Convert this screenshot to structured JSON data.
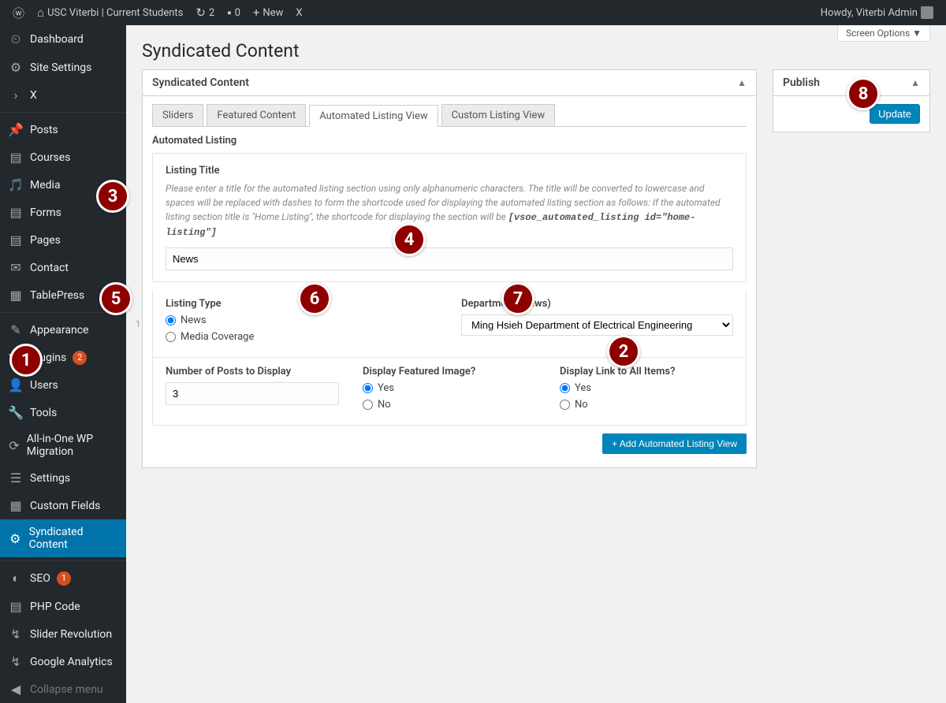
{
  "adminBar": {
    "siteName": "USC Viterbi | Current Students",
    "updates": "2",
    "comments": "0",
    "newLabel": "New",
    "xLabel": "X",
    "howdy": "Howdy, Viterbi Admin"
  },
  "sidebar": {
    "items": [
      {
        "label": "Dashboard",
        "icon": "dashboard"
      },
      {
        "label": "Site Settings",
        "icon": "gear"
      },
      {
        "label": "X",
        "icon": "chevron-right"
      },
      {
        "sep": true
      },
      {
        "label": "Posts",
        "icon": "pin"
      },
      {
        "label": "Courses",
        "icon": "book"
      },
      {
        "label": "Media",
        "icon": "camera"
      },
      {
        "label": "Forms",
        "icon": "form"
      },
      {
        "label": "Pages",
        "icon": "page"
      },
      {
        "label": "Contact",
        "icon": "mail"
      },
      {
        "label": "TablePress",
        "icon": "table"
      },
      {
        "sep": true
      },
      {
        "label": "Appearance",
        "icon": "brush"
      },
      {
        "label": "Plugins",
        "icon": "plug",
        "badge": "2"
      },
      {
        "label": "Users",
        "icon": "user"
      },
      {
        "label": "Tools",
        "icon": "wrench"
      },
      {
        "label": "All-in-One WP Migration",
        "icon": "migrate"
      },
      {
        "label": "Settings",
        "icon": "sliders"
      },
      {
        "label": "Custom Fields",
        "icon": "fields"
      },
      {
        "label": "Syndicated Content",
        "icon": "gear",
        "active": true
      },
      {
        "sep": true
      },
      {
        "label": "SEO",
        "icon": "seo",
        "badge": "1"
      },
      {
        "label": "PHP Code",
        "icon": "code"
      },
      {
        "label": "Slider Revolution",
        "icon": "slider"
      },
      {
        "label": "Google Analytics",
        "icon": "analytics"
      },
      {
        "label": "Collapse menu",
        "icon": "collapse",
        "muted": true
      }
    ]
  },
  "screenOptions": "Screen Options  ▼",
  "pageTitle": "Syndicated Content",
  "metabox": {
    "title": "Syndicated Content",
    "tabs": [
      "Sliders",
      "Featured Content",
      "Automated Listing View",
      "Custom Listing View"
    ],
    "activeTab": 2,
    "sectionLabel": "Automated Listing",
    "listingTitle": {
      "label": "Listing Title",
      "help": "Please enter a title for the automated listing section using only alphanumeric characters. The title will be converted to lowercase and spaces will be replaced with dashes to form the shortcode used for displaying the automated listing section as follows: If the automated listing section title is \"Home Listing\", the shortcode for displaying the section will be ",
      "helpCode": "[vsoe_automated_listing id=\"home-listing\"]",
      "value": "News"
    },
    "listingType": {
      "label": "Listing Type",
      "options": [
        "News",
        "Media Coverage"
      ],
      "selected": "News"
    },
    "department": {
      "label": "Department (News)",
      "value": "Ming Hsieh Department of Electrical Engineering"
    },
    "numPosts": {
      "label": "Number of Posts to Display",
      "value": "3"
    },
    "featuredImage": {
      "label": "Display Featured Image?",
      "options": [
        "Yes",
        "No"
      ],
      "selected": "Yes"
    },
    "linkAll": {
      "label": "Display Link to All Items?",
      "options": [
        "Yes",
        "No"
      ],
      "selected": "Yes"
    },
    "addButton": "+ Add Automated Listing View"
  },
  "publish": {
    "title": "Publish",
    "updateLabel": "Update"
  },
  "callouts": [
    "1",
    "2",
    "3",
    "4",
    "5",
    "6",
    "7",
    "8"
  ]
}
